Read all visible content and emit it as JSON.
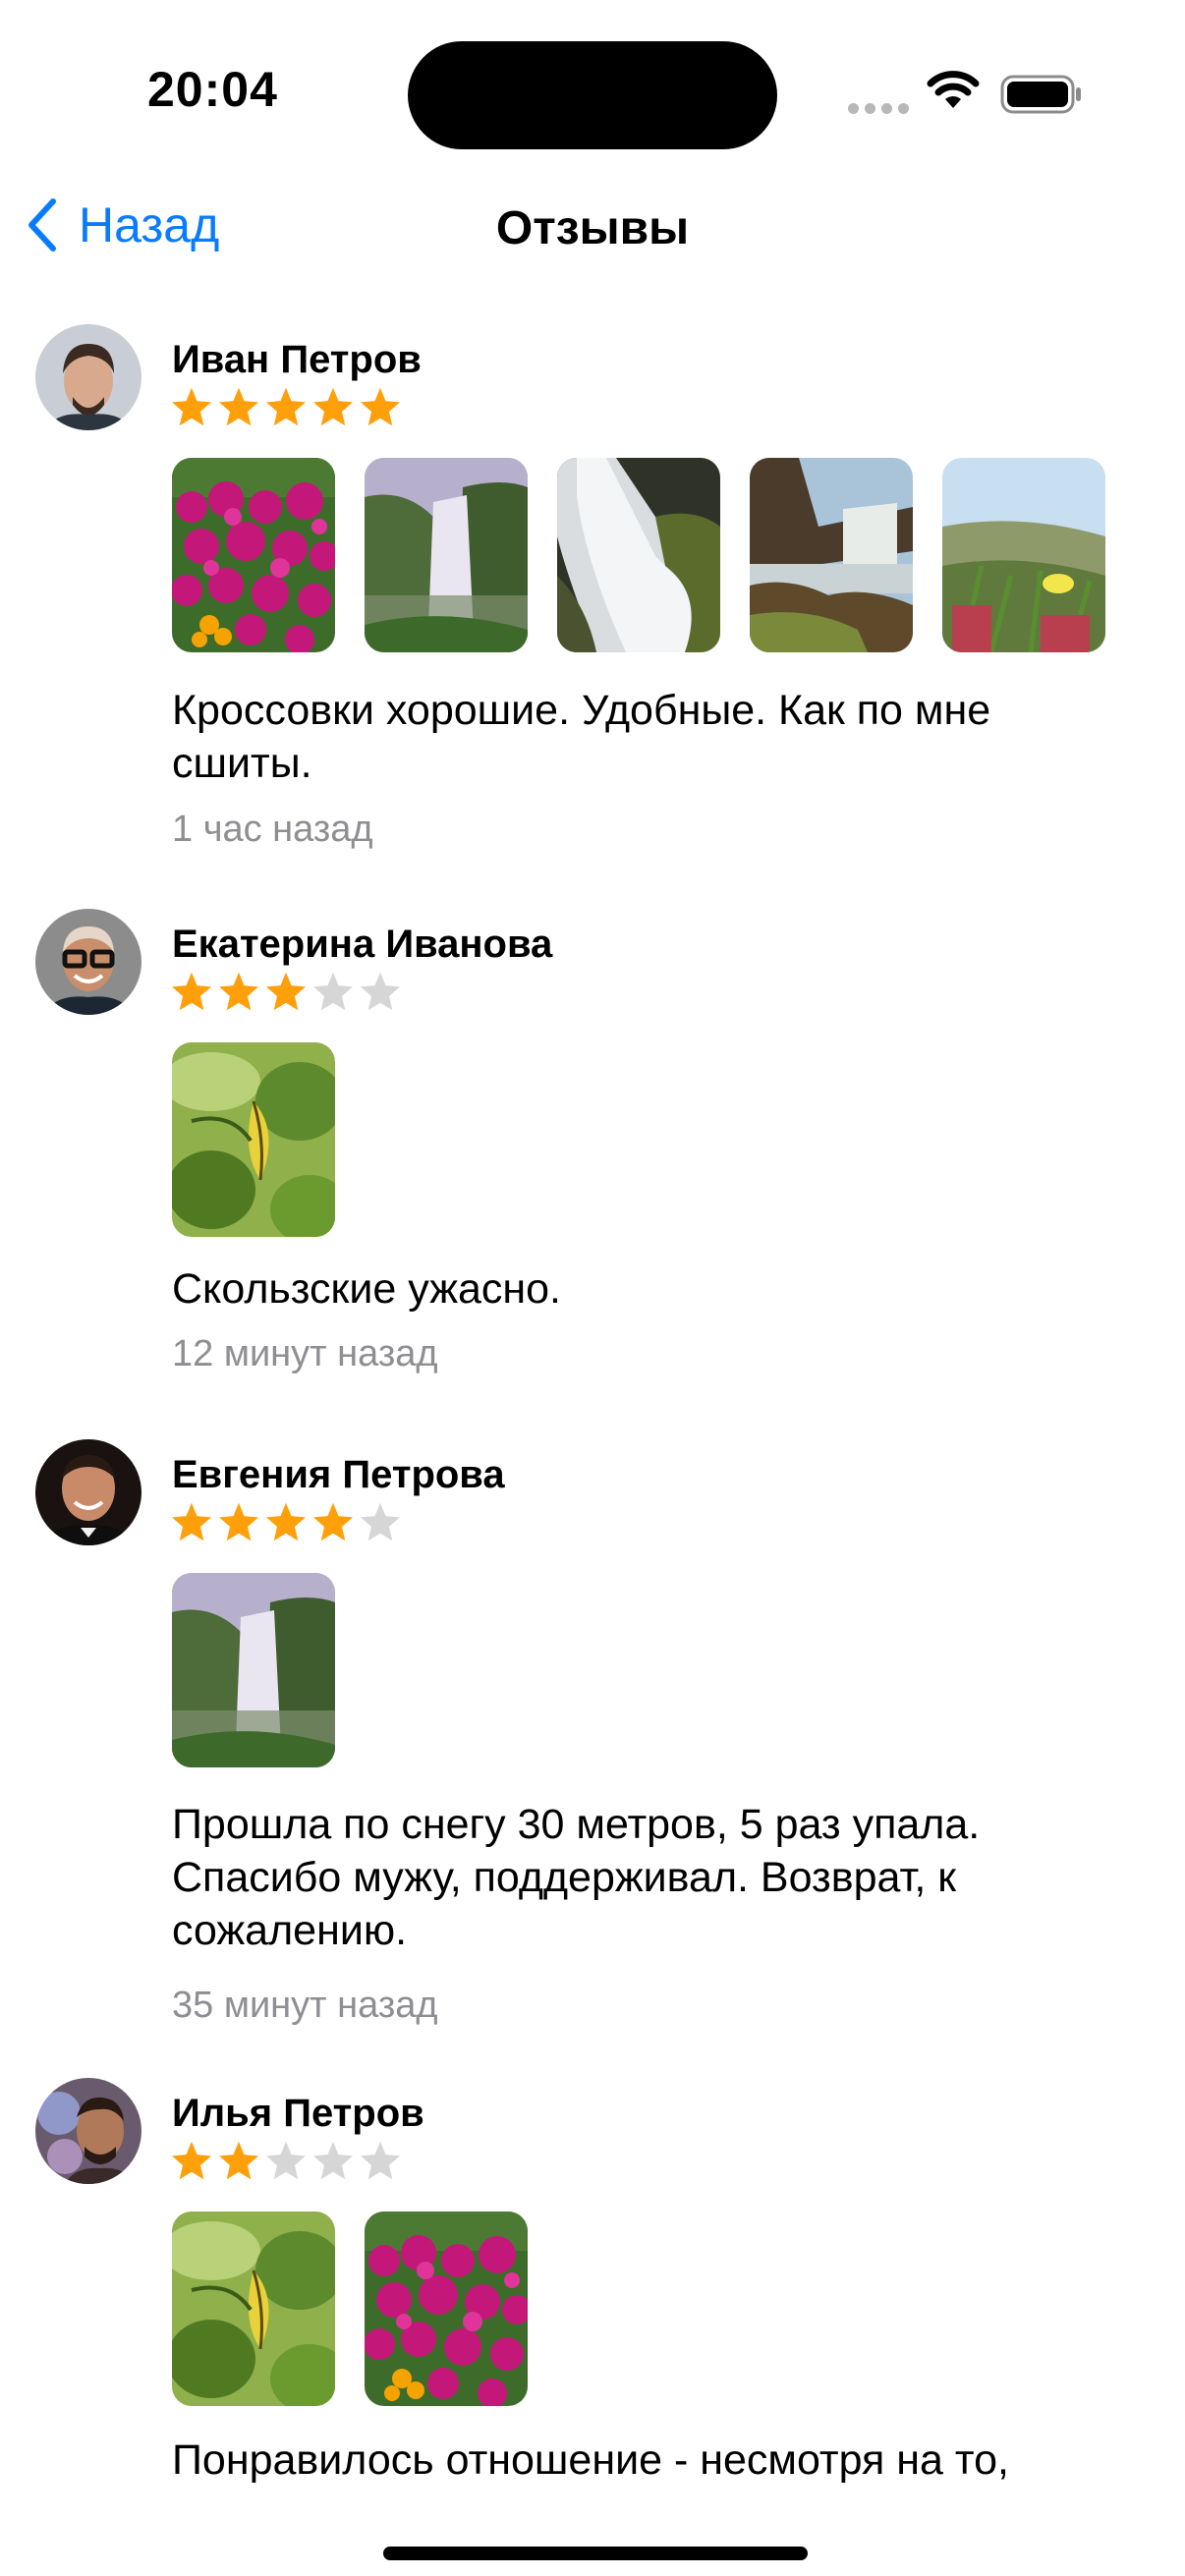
{
  "status_bar": {
    "time": "20:04"
  },
  "nav": {
    "back_label": "Назад",
    "title": "Отзывы",
    "back_icon": "chevron-left-icon"
  },
  "colors": {
    "accent": "#0a7bff",
    "star_filled": "#ff9f0a",
    "star_empty": "#d6d6d6",
    "secondary_text": "#8e8e93"
  },
  "reviews": [
    {
      "author": "Иван Петров",
      "rating": 5,
      "max_rating": 5,
      "photos": [
        "flowers-photo",
        "waterfall-photo",
        "rapids-photo",
        "cliff-waterfall-photo",
        "field-flower-photo"
      ],
      "text": "Кроссовки хорошие. Удобные. Как по мне сшиты.",
      "time": "1 час назад"
    },
    {
      "author": "Екатерина Иванова",
      "rating": 3,
      "max_rating": 5,
      "photos": [
        "leaf-photo"
      ],
      "text": "Скользские ужасно.",
      "time": "12 минут назад"
    },
    {
      "author": "Евгения Петрова",
      "rating": 4,
      "max_rating": 5,
      "photos": [
        "waterfall-photo"
      ],
      "text": "Прошла по снегу 30 метров, 5 раз упала. Спасибо мужу, поддерживал. Возврат, к сожалению.",
      "time": "35 минут назад"
    },
    {
      "author": "Илья Петров",
      "rating": 2,
      "max_rating": 5,
      "photos": [
        "leaf-photo",
        "flowers-photo"
      ],
      "text": "Понравилось отношение - несмотря на то,"
    }
  ]
}
